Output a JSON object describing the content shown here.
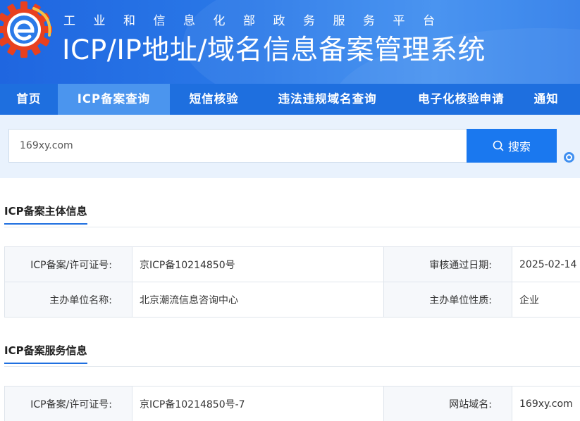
{
  "header": {
    "subtitle": "工业和信息化部政务服务平台",
    "title": "ICP/IP地址/域名信息备案管理系统",
    "logo_icon": "gear-e-logo-icon"
  },
  "nav": {
    "items": [
      {
        "label": "首页"
      },
      {
        "label": "ICP备案查询"
      },
      {
        "label": "短信核验"
      },
      {
        "label": "违法违规域名查询"
      },
      {
        "label": "电子化核验申请"
      },
      {
        "label": "通知"
      }
    ],
    "active_index": 1
  },
  "search": {
    "value": "169xy.com",
    "button_label": "搜索",
    "button_icon": "search-icon"
  },
  "sections": {
    "subject": {
      "title": "ICP备案主体信息",
      "rows": [
        {
          "l1": "ICP备案/许可证号:",
          "v1": "京ICP备10214850号",
          "l2": "审核通过日期:",
          "v2": "2025-02-14"
        },
        {
          "l1": "主办单位名称:",
          "v1": "北京潮流信息咨询中心",
          "l2": "主办单位性质:",
          "v2": "企业"
        }
      ]
    },
    "service": {
      "title": "ICP备案服务信息",
      "rows": [
        {
          "l1": "ICP备案/许可证号:",
          "v1": "京ICP备10214850号-7",
          "l2": "网站域名:",
          "v2": "169xy.com"
        }
      ]
    }
  },
  "colors": {
    "header_blue": "#2b7ae8",
    "nav_blue": "#1e6fdf",
    "nav_active": "#4b95ee",
    "search_button": "#1a78ef",
    "search_bg": "#e9f2fd"
  }
}
